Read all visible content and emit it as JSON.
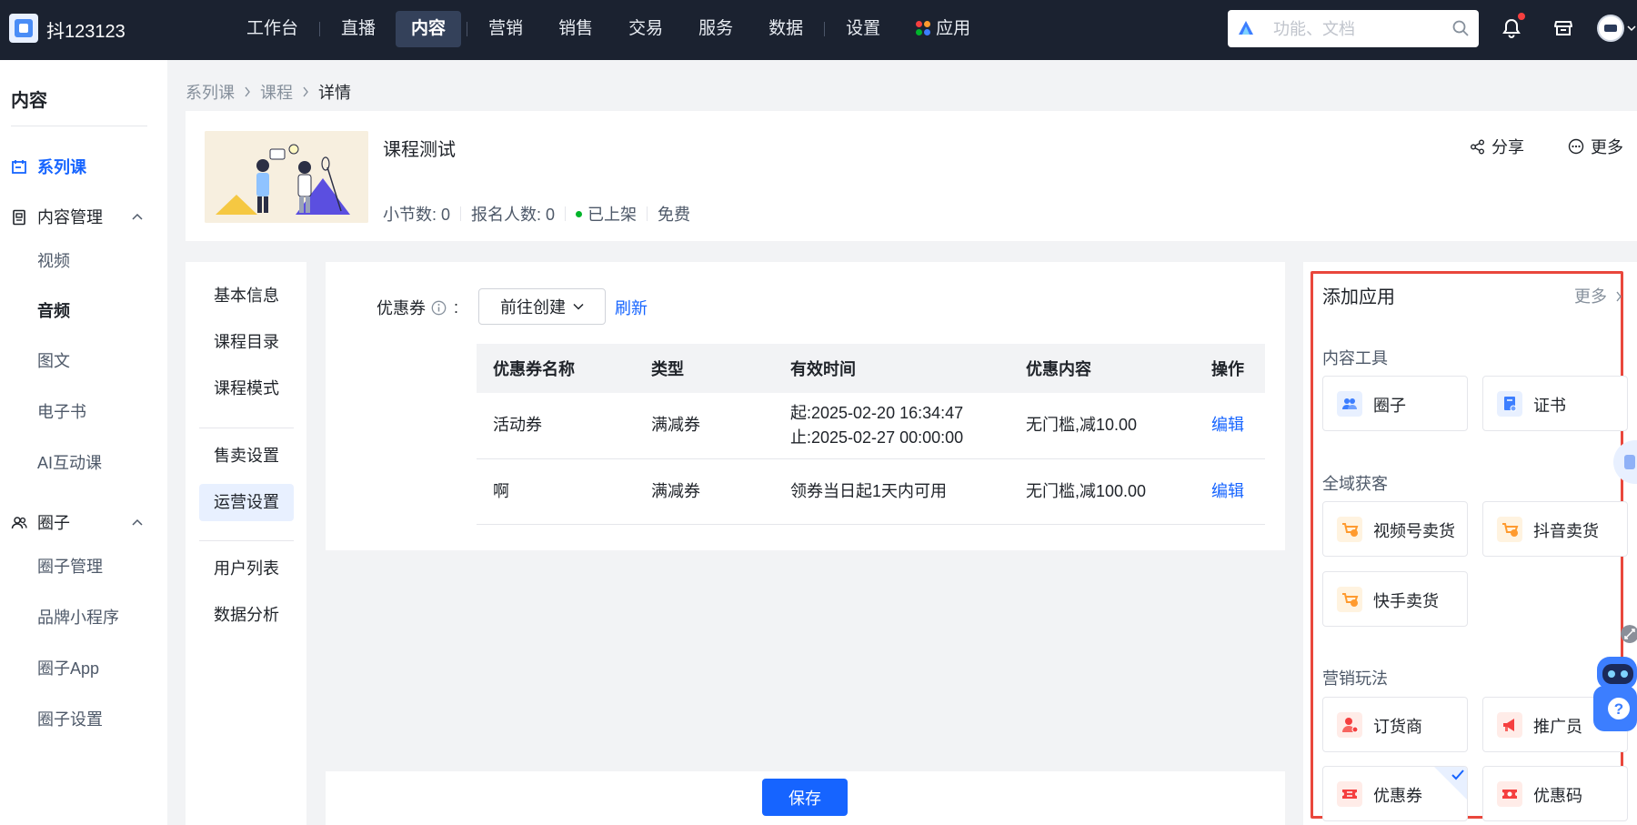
{
  "topbar": {
    "shop_name": "抖123123",
    "nav": [
      "工作台",
      "直播",
      "内容",
      "营销",
      "销售",
      "交易",
      "服务",
      "数据",
      "设置",
      "应用"
    ],
    "active_nav": "内容",
    "search_placeholder": "功能、文档"
  },
  "sidebar": {
    "title": "内容",
    "active_item": "系列课",
    "items": {
      "series": "系列课",
      "content_mgmt": "内容管理",
      "video": "视频",
      "audio": "音频",
      "graphic": "图文",
      "ebook": "电子书",
      "ai_course": "AI互动课",
      "circle": "圈子",
      "circle_mgmt": "圈子管理",
      "brand_mini": "品牌小程序",
      "circle_app": "圈子App",
      "circle_settings": "圈子设置"
    }
  },
  "breadcrumb": [
    "系列课",
    "课程",
    "详情"
  ],
  "course": {
    "title": "课程测试",
    "lesson_count": "小节数: 0",
    "enroll_count": "报名人数: 0",
    "status": "已上架",
    "price": "免费",
    "share_label": "分享",
    "more_label": "更多"
  },
  "settings_menu": {
    "active": "运营设置",
    "items": [
      "基本信息",
      "课程目录",
      "课程模式",
      "售卖设置",
      "运营设置",
      "用户列表",
      "数据分析"
    ]
  },
  "coupon": {
    "label": "优惠券",
    "colon": ":",
    "create_button": "前往创建",
    "refresh_link": "刷新",
    "columns": [
      "优惠券名称",
      "类型",
      "有效时间",
      "优惠内容",
      "操作"
    ],
    "rows": [
      {
        "name": "活动券",
        "type": "满减券",
        "time_start": "起:2025-02-20 16:34:47",
        "time_end": "止:2025-02-27 00:00:00",
        "content": "无门槛,减10.00",
        "action": "编辑"
      },
      {
        "name": "啊",
        "type": "满减券",
        "time": "领券当日起1天内可用",
        "content": "无门槛,减100.00",
        "action": "编辑"
      }
    ]
  },
  "save_button": "保存",
  "apps_panel": {
    "title": "添加应用",
    "more": "更多",
    "sections": {
      "content_tools": {
        "title": "内容工具",
        "apps": [
          "圈子",
          "证书"
        ]
      },
      "acquisition": {
        "title": "全域获客",
        "apps": [
          "视频号卖货",
          "抖音卖货",
          "快手卖货"
        ]
      },
      "marketing": {
        "title": "营销玩法",
        "apps": [
          "订货商",
          "推广员",
          "优惠券",
          "优惠码"
        ]
      }
    },
    "selected_app": "优惠券"
  },
  "colors": {
    "topbar_bg": "#1b2230",
    "accent": "#1664ff",
    "highlight_border": "#e9473c",
    "status_green": "#00b42a"
  }
}
